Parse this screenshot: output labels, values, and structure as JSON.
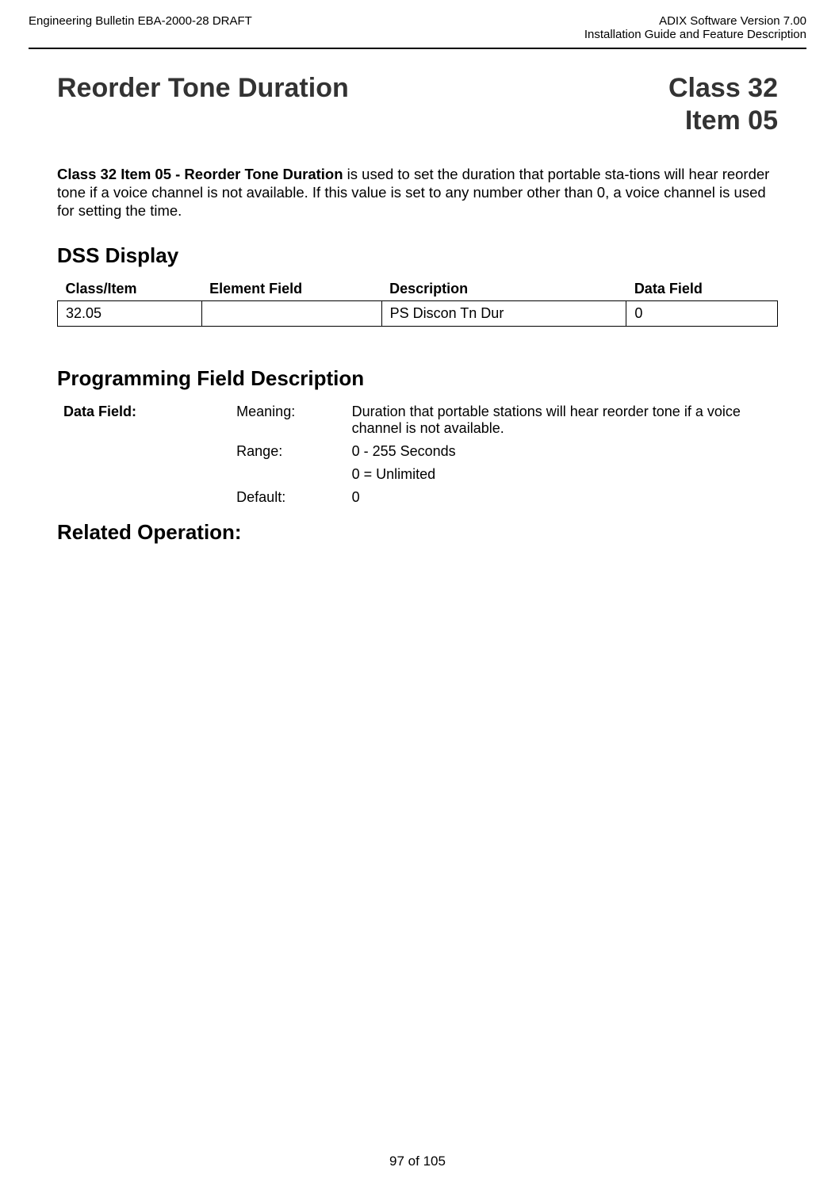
{
  "header": {
    "left": "Engineering Bulletin EBA-2000-28 DRAFT",
    "right_line1": "ADIX Software Version 7.00",
    "right_line2": "Installation Guide and Feature Description"
  },
  "title": {
    "left": "Reorder Tone Duration",
    "right_line1": "Class 32",
    "right_line2": "Item 05"
  },
  "intro": {
    "bold": "Class 32 Item 05 - Reorder Tone Duration",
    "rest": " is used to set the duration that portable sta-tions will hear reorder tone if a voice channel is not available. If this value is set to any number other than 0, a voice channel is used for setting the time."
  },
  "dss": {
    "heading": "DSS Display",
    "headers": {
      "classitem": "Class/Item",
      "element": "Element Field",
      "description": "Description",
      "datafield": "Data Field"
    },
    "row": {
      "classitem": "32.05",
      "element": "",
      "description": "PS Discon Tn Dur",
      "datafield": "0"
    }
  },
  "pfd": {
    "heading": "Programming Field Description",
    "label": "Data Field:",
    "rows": [
      {
        "key": "Meaning:",
        "val": "Duration that portable stations will hear reorder tone if a voice channel is not available."
      },
      {
        "key": "Range:",
        "val": "0 - 255 Seconds"
      },
      {
        "key": "",
        "val": "0 = Unlimited"
      },
      {
        "key": "Default:",
        "val": "0"
      }
    ]
  },
  "related": {
    "heading": "Related Operation:"
  },
  "footer": {
    "page": "97 of 105"
  }
}
